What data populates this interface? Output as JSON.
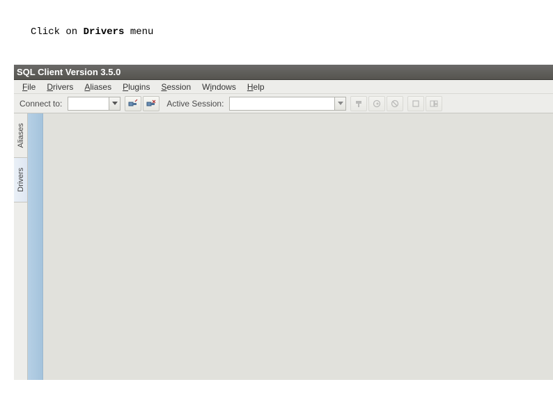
{
  "instruction": {
    "prefix": "Click on ",
    "bold": "Drivers",
    "suffix": " menu"
  },
  "titlebar": {
    "text": "SQL Client Version 3.5.0"
  },
  "menu": {
    "file": {
      "u": "F",
      "rest": "ile"
    },
    "drivers": {
      "u": "D",
      "rest": "rivers"
    },
    "aliases": {
      "u": "A",
      "rest": "liases"
    },
    "plugins": {
      "u": "P",
      "rest": "lugins"
    },
    "session": {
      "u": "S",
      "rest": "ession"
    },
    "windows": {
      "pre": "W",
      "u": "i",
      "rest": "ndows"
    },
    "help": {
      "u": "H",
      "rest": "elp"
    }
  },
  "toolbar": {
    "connect_label": "Connect to:",
    "active_label": "Active Session:"
  },
  "sidebar": {
    "aliases": "Aliases",
    "drivers": "Drivers"
  }
}
